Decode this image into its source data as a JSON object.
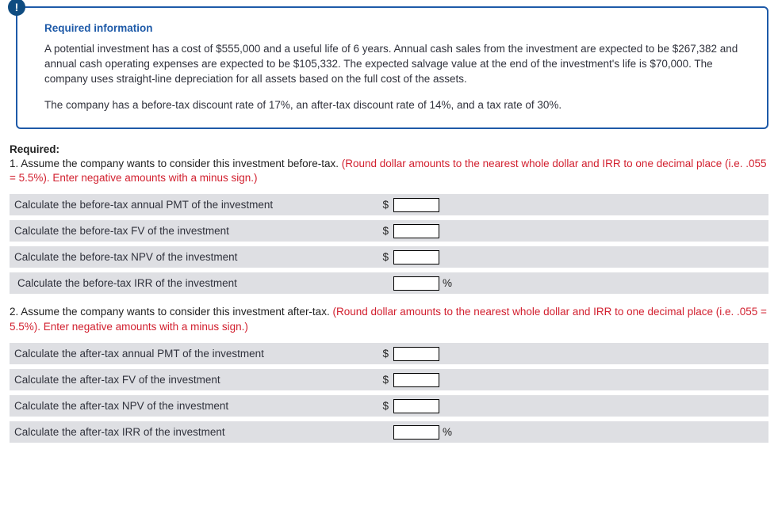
{
  "info": {
    "title": "Required information",
    "para1": "A potential investment has a cost of $555,000 and a useful life of 6 years. Annual cash sales from the investment are expected to be $267,382 and annual cash operating expenses are expected to be $105,332. The expected salvage value at the end of the investment's life is $70,000.  The company uses straight-line depreciation for all assets based on the full cost of the assets.",
    "para2": "The company has a before-tax discount rate of 17%, an after-tax discount rate of 14%, and a tax rate of 30%."
  },
  "required_label": "Required:",
  "q1": {
    "prefix": "1. Assume the company wants to consider this investment before-tax. ",
    "red": "(Round dollar amounts to the nearest whole dollar and IRR to one decimal place (i.e. .055 = 5.5%). Enter negative amounts with a minus sign.)",
    "rows": [
      {
        "label": "Calculate the before-tax annual PMT of the investment",
        "prefix": "$",
        "suffix": ""
      },
      {
        "label": "Calculate the before-tax FV of the investment",
        "prefix": "$",
        "suffix": ""
      },
      {
        "label": "Calculate the before-tax NPV of the investment",
        "prefix": "$",
        "suffix": ""
      },
      {
        "label": "Calculate the before-tax IRR of the investment",
        "prefix": "",
        "suffix": "%"
      }
    ]
  },
  "q2": {
    "prefix": "2. Assume the company wants to consider this investment after-tax. ",
    "red": "(Round dollar amounts to the nearest whole dollar and IRR to one decimal place (i.e. .055 = 5.5%). Enter negative amounts with a minus sign.)",
    "rows": [
      {
        "label": "Calculate the after-tax annual PMT of the investment",
        "prefix": "$",
        "suffix": ""
      },
      {
        "label": "Calculate the after-tax FV of the investment",
        "prefix": "$",
        "suffix": ""
      },
      {
        "label": "Calculate the after-tax NPV of the investment",
        "prefix": "$",
        "suffix": ""
      },
      {
        "label": "Calculate the after-tax IRR of the investment",
        "prefix": "",
        "suffix": "%"
      }
    ]
  }
}
